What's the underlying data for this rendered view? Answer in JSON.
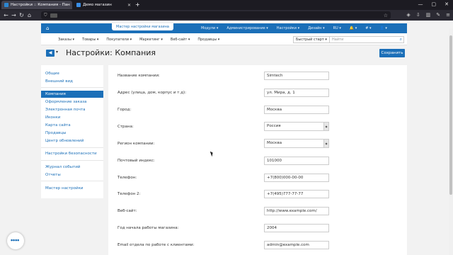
{
  "browser": {
    "tabs": [
      {
        "title": "Настройки :: Компания - Пан"
      },
      {
        "title": "Демо магазин"
      }
    ],
    "new_tab": "+"
  },
  "app_top": {
    "wizard": "Мастер настройки магазина",
    "menu": [
      "Модули ▾",
      "Администрирование ▾",
      "Настройки ▾",
      "Дизайн ▾",
      "RU ▾",
      "🔔 ▾",
      "# ▾",
      "👤 ▾"
    ]
  },
  "menu_bar": {
    "items": [
      "Заказы ▾",
      "Товары ▾",
      "Покупатели ▾",
      "Маркетинг ▾",
      "Веб-сайт ▾",
      "Продавцы ▾"
    ],
    "quick_start": "Быстрый старт ▾",
    "search_placeholder": "Найти"
  },
  "page": {
    "title": "Настройки: Компания",
    "save": "Сохранить"
  },
  "sidebar": {
    "group1": [
      "Общие",
      "Внешний вид"
    ],
    "group2": [
      "Компания",
      "Оформление заказа",
      "Электронная почта",
      "Иконки",
      "Карта сайта",
      "Продавцы",
      "Центр обновлений"
    ],
    "group3": [
      "Настройки безопасности"
    ],
    "group4": [
      "Журнал событий",
      "Отчеты"
    ],
    "group5": [
      "Мастер настройки"
    ]
  },
  "form": [
    {
      "label": "Название компании:",
      "value": "Simtech",
      "type": "input"
    },
    {
      "label": "Адрес (улица, дом, корпус и т.д):",
      "value": "ул. Мира, д. 1",
      "type": "input"
    },
    {
      "label": "Город:",
      "value": "Москва",
      "type": "input"
    },
    {
      "label": "Страна:",
      "value": "Россия",
      "type": "select"
    },
    {
      "label": "Регион компании:",
      "value": "Москва",
      "type": "select"
    },
    {
      "label": "Почтовый индекс:",
      "value": "101000",
      "type": "input"
    },
    {
      "label": "Телефон:",
      "value": "+7(800)000-00-00",
      "type": "input"
    },
    {
      "label": "Телефон 2:",
      "value": "+7(495)777-77-77",
      "type": "input"
    },
    {
      "label": "Веб-сайт:",
      "value": "http://www.example.com/",
      "type": "input"
    },
    {
      "label": "Год начала работы магазина:",
      "value": "2004",
      "type": "input"
    },
    {
      "label": "Email отдела по работе с клиентами:",
      "value": "admin@example.com",
      "type": "input"
    }
  ],
  "colors": {
    "accent": "#1b6fb8",
    "background": "#f2f2f2"
  }
}
